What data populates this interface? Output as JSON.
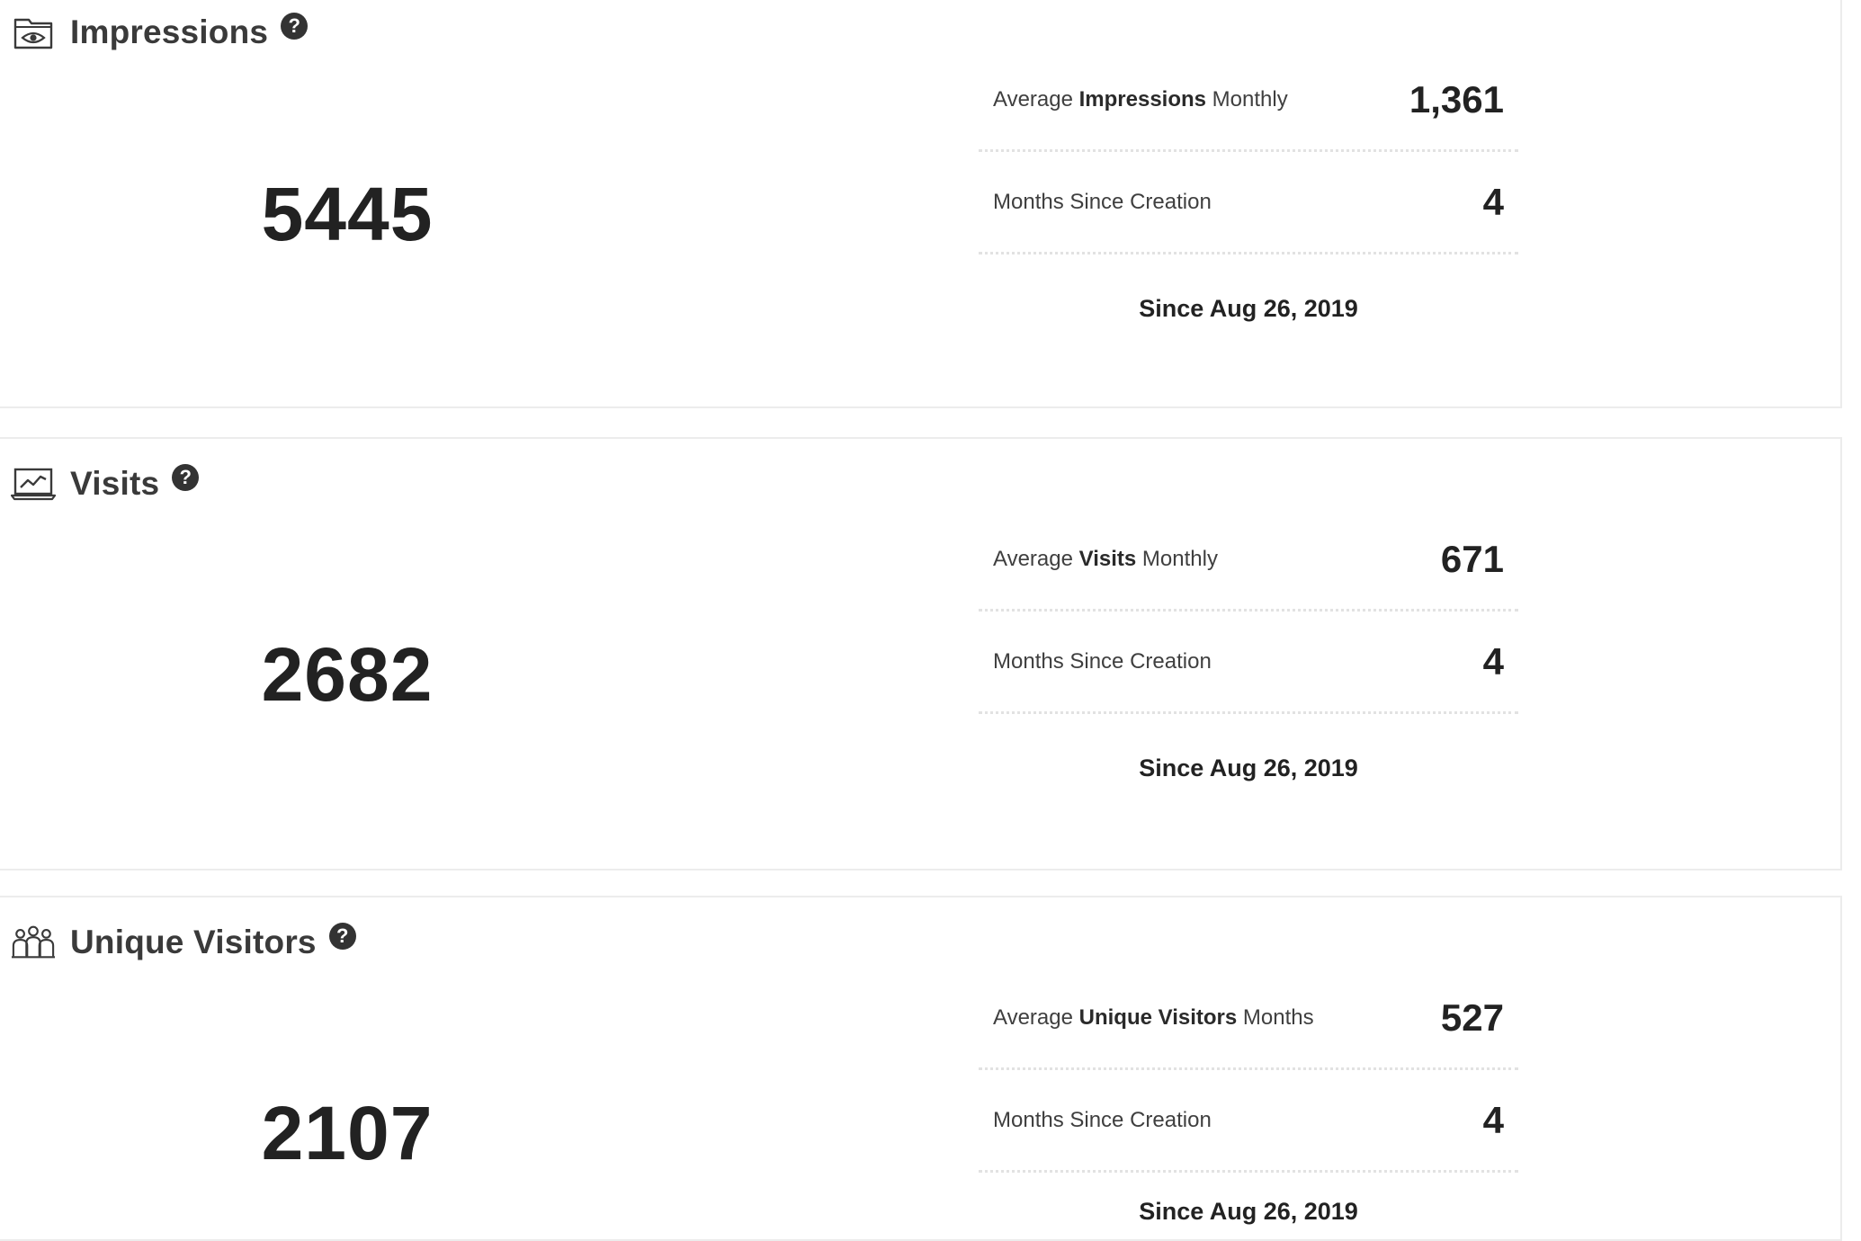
{
  "sections": [
    {
      "title": "Impressions",
      "icon": "eye-icon",
      "help_glyph": "?",
      "total": "5445",
      "avg_prefix": "Average ",
      "avg_bold": "Impressions",
      "avg_suffix": " Monthly",
      "avg_value": "1,361",
      "months_label": "Months Since Creation",
      "months_value": "4",
      "since": "Since Aug 26, 2019"
    },
    {
      "title": "Visits",
      "icon": "line-chart-icon",
      "help_glyph": "?",
      "total": "2682",
      "avg_prefix": "Average ",
      "avg_bold": "Visits",
      "avg_suffix": " Monthly",
      "avg_value": "671",
      "months_label": "Months Since Creation",
      "months_value": "4",
      "since": "Since Aug 26, 2019"
    },
    {
      "title": "Unique Visitors",
      "icon": "people-icon",
      "help_glyph": "?",
      "total": "2107",
      "avg_prefix": "Average ",
      "avg_bold": "Unique Visitors",
      "avg_suffix": " Months",
      "avg_value": "527",
      "months_label": "Months Since Creation",
      "months_value": "4",
      "since": "Since Aug 26, 2019"
    }
  ],
  "colors": {
    "text_dark": "#222222",
    "text_label": "#3f3f3f",
    "help_bg": "#333333",
    "border": "#ececec",
    "divider_dotted": "#e2e2e2"
  }
}
